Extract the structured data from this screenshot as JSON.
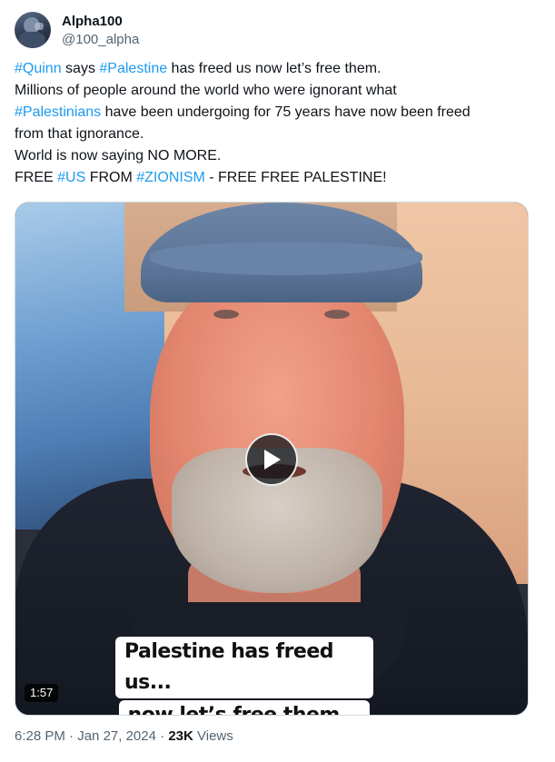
{
  "author": {
    "display_name": "Alpha100",
    "handle": "@100_alpha",
    "avatar_icon": "profile-photo"
  },
  "tweet": {
    "lines": [
      [
        {
          "text": "#Quinn",
          "type": "hashtag"
        },
        {
          "text": " says ",
          "type": "text"
        },
        {
          "text": "#Palestine",
          "type": "hashtag"
        },
        {
          "text": " has freed us now let’s free them.",
          "type": "text"
        }
      ],
      [
        {
          "text": "Millions of people around the world who were ignorant what",
          "type": "text"
        }
      ],
      [
        {
          "text": "#Palestinians",
          "type": "hashtag"
        },
        {
          "text": " have been undergoing for 75 years have now been freed",
          "type": "text"
        }
      ],
      [
        {
          "text": "from that ignorance.",
          "type": "text"
        }
      ],
      [
        {
          "text": "World is now saying NO MORE.",
          "type": "text"
        }
      ],
      [
        {
          "text": "FREE ",
          "type": "text"
        },
        {
          "text": "#US",
          "type": "hashtag"
        },
        {
          "text": " FROM ",
          "type": "text"
        },
        {
          "text": "#ZIONISM",
          "type": "hashtag"
        },
        {
          "text": " - FREE FREE PALESTINE!",
          "type": "text"
        }
      ]
    ]
  },
  "video": {
    "caption_line1": "Palestine has freed us...",
    "caption_line2": "now let’s free them...",
    "duration": "1:57",
    "play_icon": "play-icon"
  },
  "meta": {
    "time": "6:28 PM",
    "separator1": " · ",
    "date": "Jan 27, 2024",
    "separator2": " · ",
    "views_count": "23K",
    "views_label": " Views"
  },
  "colors": {
    "hashtag": "#1d9bf0",
    "text_primary": "#0f1419",
    "text_secondary": "#536471",
    "border": "#cfd9de"
  }
}
